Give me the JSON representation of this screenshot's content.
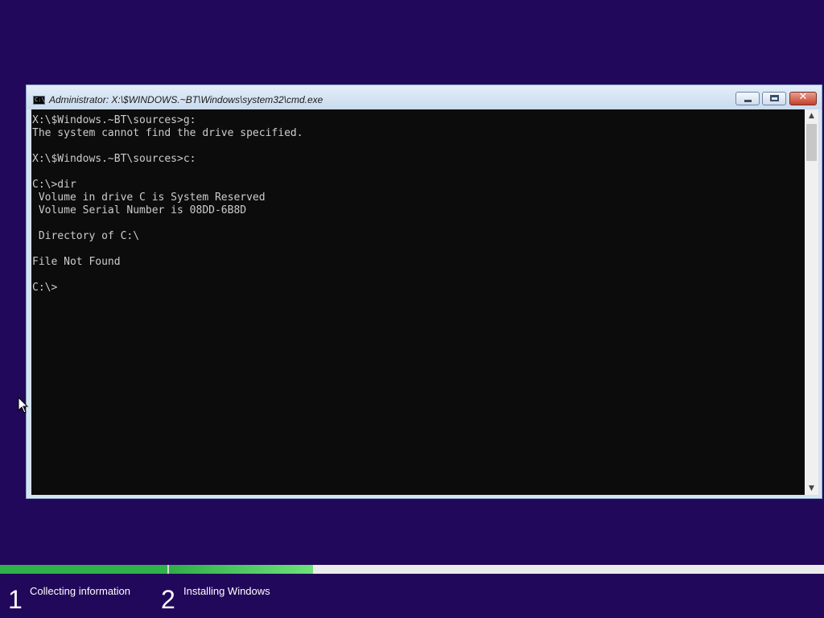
{
  "window": {
    "title": "Administrator: X:\\$WINDOWS.~BT\\Windows\\system32\\cmd.exe",
    "icon": "cmd-console-icon",
    "controls": [
      "minimize-icon",
      "maximize-icon",
      "close-icon"
    ],
    "close_glyph": "✕"
  },
  "console": {
    "lines": [
      "X:\\$Windows.~BT\\sources>g:",
      "The system cannot find the drive specified.",
      "",
      "X:\\$Windows.~BT\\sources>c:",
      "",
      "C:\\>dir",
      " Volume in drive C is System Reserved",
      " Volume Serial Number is 08DD-6B8D",
      "",
      " Directory of C:\\",
      "",
      "File Not Found",
      "",
      "C:\\>"
    ]
  },
  "setup": {
    "steps": [
      {
        "number": "1",
        "label": "Collecting information",
        "progress": 1.0
      },
      {
        "number": "2",
        "label": "Installing Windows",
        "progress": 0.22
      }
    ]
  },
  "colors": {
    "background": "#22085a",
    "progress": "#30b14a",
    "console_bg": "#0c0c0c",
    "console_fg": "#cccccc"
  },
  "cursor": {
    "icon": "mouse-pointer-icon"
  }
}
